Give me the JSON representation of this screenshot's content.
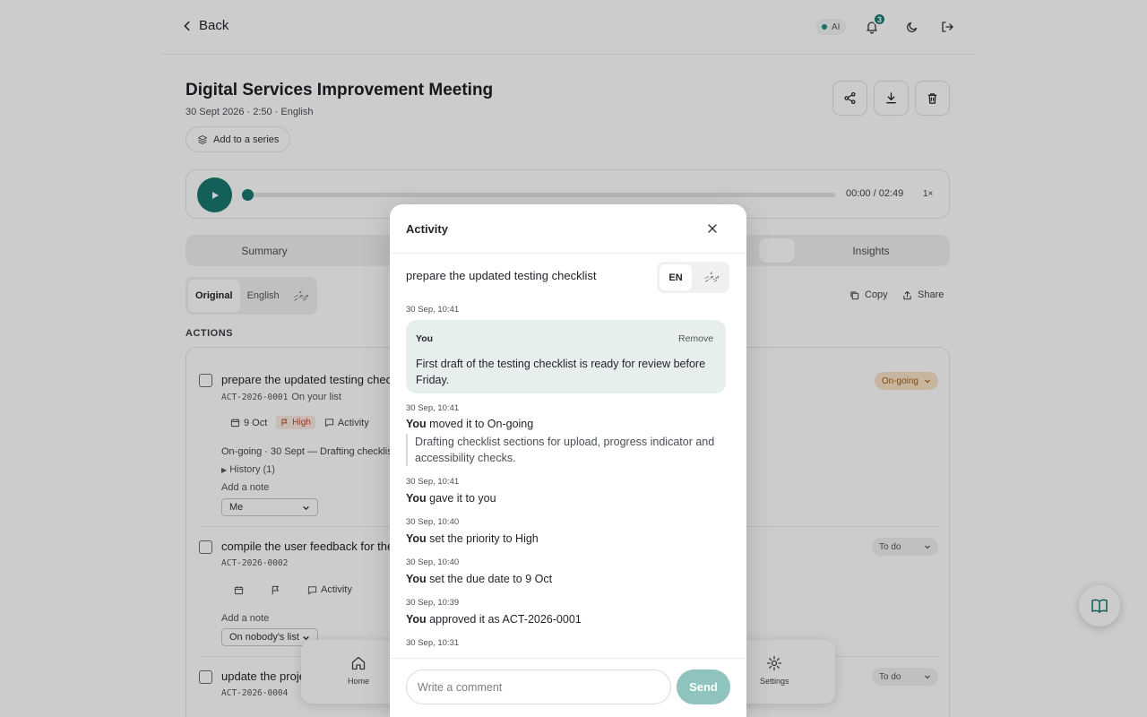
{
  "header": {
    "back_label": "Back",
    "ai_label": "AI",
    "notification_count": "3"
  },
  "meeting": {
    "title": "Digital Services Improvement Meeting",
    "meta": "30 Sept 2026 · 2:50 · English",
    "add_series_label": "Add to a series"
  },
  "player": {
    "time": "00:00 / 02:49",
    "speed": "1×",
    "progress": 0
  },
  "tabs": [
    {
      "label": "Summary"
    },
    {
      "label": "Insights"
    }
  ],
  "language_switch": {
    "options": [
      "Original",
      "English",
      "ދިވެހި"
    ],
    "active": "Original"
  },
  "tools": {
    "copy_label": "Copy",
    "share_label": "Share"
  },
  "actions": {
    "section_label": "ACTIONS",
    "items": [
      {
        "title": "prepare the updated testing checklist",
        "id": "ACT-2026-0001",
        "list": "On your list",
        "due": "9 Oct",
        "priority": "High",
        "activity_label": "Activity",
        "status": "On-going",
        "status_line": "On-going · 30 Sept — Drafting checklist",
        "history_label": "History (1)",
        "note_label": "Add a note",
        "assignee": "Me"
      },
      {
        "title": "compile the user feedback for the",
        "id": "ACT-2026-0002",
        "activity_label": "Activity",
        "status": "To do",
        "note_label": "Add a note",
        "assignee": "On nobody's list"
      },
      {
        "title": "update the proje",
        "id": "ACT-2026-0004",
        "status": "To do"
      }
    ]
  },
  "bottom_nav": [
    {
      "label": "Home",
      "icon": "home-icon"
    },
    {
      "label": "Settings",
      "icon": "gear-icon"
    }
  ],
  "modal": {
    "title": "Activity",
    "task": "prepare the updated testing checklist",
    "lang_en": "EN",
    "lang_dv": "ދިވެހި",
    "comment": {
      "timestamp": "30 Sep, 10:41",
      "author": "You",
      "remove_label": "Remove",
      "text": "First draft of the testing checklist is ready for review before Friday."
    },
    "events": [
      {
        "timestamp": "30 Sep, 10:41",
        "actor": "You",
        "text": "moved it to On-going",
        "quote": "Drafting checklist sections for upload, progress indicator and accessibility checks."
      },
      {
        "timestamp": "30 Sep, 10:41",
        "actor": "You",
        "text": "gave it to you"
      },
      {
        "timestamp": "30 Sep, 10:40",
        "actor": "You",
        "text": "set the priority to High"
      },
      {
        "timestamp": "30 Sep, 10:40",
        "actor": "You",
        "text": "set the due date to 9 Oct"
      },
      {
        "timestamp": "30 Sep, 10:39",
        "actor": "You",
        "text": "approved it as ACT-2026-0001"
      },
      {
        "timestamp": "30 Sep, 10:31"
      }
    ],
    "comment_placeholder": "Write a comment",
    "send_label": "Send"
  },
  "colors": {
    "accent": "#17796f",
    "send_disabled": "#8fc3bd",
    "status_ongoing_bg": "#fbe3c9",
    "priority_high": "#b84a28"
  }
}
